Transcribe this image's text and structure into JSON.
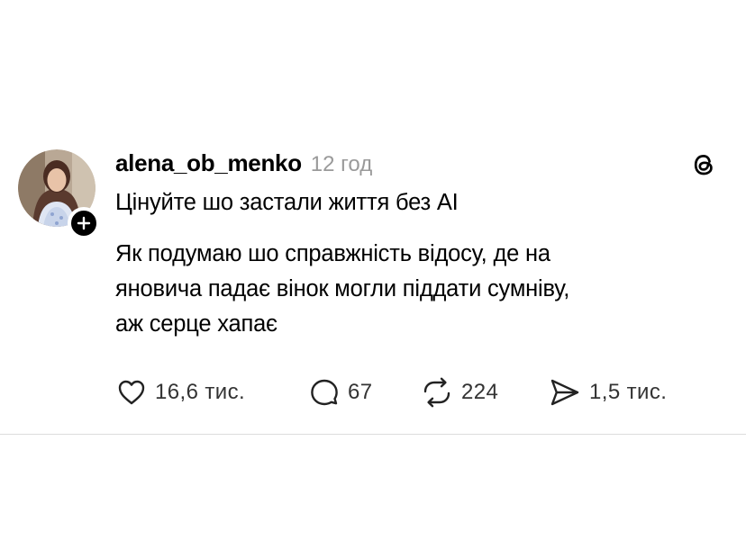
{
  "post": {
    "username": "alena_ob_menko",
    "time": "12 год",
    "title": "Цінуйте шо застали життя без AI",
    "text": "Як подумаю шо справжність відосу, де на\nяновича падає вінок могли піддати сумніву,\nаж серце хапає",
    "likes": "16,6 тис.",
    "replies": "67",
    "reposts": "224",
    "shares": "1,5 тис."
  },
  "icons": {
    "follow": "plus-icon",
    "app": "threads-logo-icon",
    "like": "heart-icon",
    "reply": "comment-icon",
    "repost": "repost-icon",
    "share": "send-icon"
  },
  "colors": {
    "text": "#000000",
    "muted": "#9a9a9a",
    "counts": "#333333",
    "divider": "#dcdcdc"
  }
}
